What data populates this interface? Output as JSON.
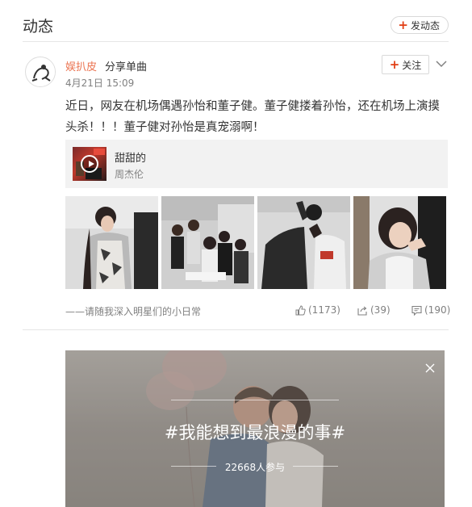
{
  "header": {
    "title": "动态",
    "post_button_label": "发动态"
  },
  "post": {
    "author": "娱扒皮",
    "action": "分享单曲",
    "time": "4月21日 15:09",
    "follow_label": "关注",
    "text": "近日，网友在机场偶遇孙怡和董子健。董子健搂着孙怡，还在机场上演摸头杀！！！董子健对孙怡是真宠溺啊！",
    "music": {
      "title": "甜甜的",
      "artist": "周杰伦"
    },
    "footer_note": "——请随我深入明星们的小日常",
    "stats": {
      "likes": "(1173)",
      "reposts": "(39)",
      "comments": "(190)"
    }
  },
  "banner": {
    "title": "#我能想到最浪漫的事#",
    "participants": "22668人参与"
  },
  "colors": {
    "author_link": "#eb7350",
    "accent_red": "#e13d13",
    "muted_text": "#808080"
  },
  "icons": [
    "plus-icon",
    "chevron-down-icon",
    "play-icon",
    "like-icon",
    "repost-icon",
    "comment-icon",
    "close-icon"
  ]
}
